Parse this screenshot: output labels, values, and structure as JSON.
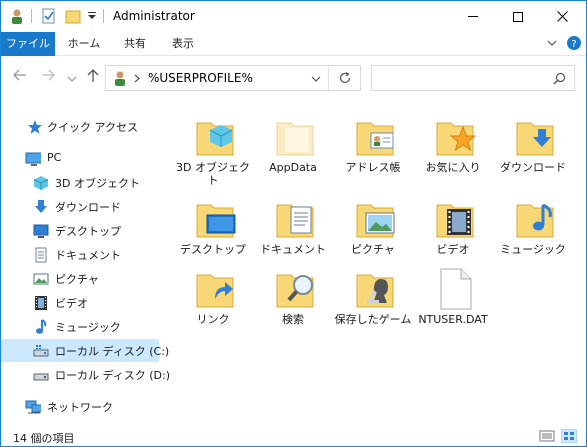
{
  "window": {
    "title": "Administrator"
  },
  "ribbon": {
    "tabs": [
      "ファイル",
      "ホーム",
      "共有",
      "表示"
    ]
  },
  "address": {
    "path": "%USERPROFILE%"
  },
  "search": {
    "placeholder": ""
  },
  "sidebar": {
    "items": [
      {
        "label": "クイック アクセス",
        "icon": "quick-access-star"
      },
      {
        "label": "PC",
        "icon": "pc-monitor"
      },
      {
        "label": "3D オブジェクト",
        "icon": "3d-objects-cube"
      },
      {
        "label": "ダウンロード",
        "icon": "download-arrow"
      },
      {
        "label": "デスクトップ",
        "icon": "desktop-monitor"
      },
      {
        "label": "ドキュメント",
        "icon": "document"
      },
      {
        "label": "ピクチャ",
        "icon": "pictures"
      },
      {
        "label": "ビデオ",
        "icon": "video-film"
      },
      {
        "label": "ミュージック",
        "icon": "music-note"
      },
      {
        "label": "ローカル ディスク (C:)",
        "icon": "local-disk"
      },
      {
        "label": "ローカル ディスク (D:)",
        "icon": "local-disk"
      },
      {
        "label": "ネットワーク",
        "icon": "network"
      }
    ]
  },
  "files": [
    {
      "label": "3D オブジェクト",
      "icon": "3d-objects-folder"
    },
    {
      "label": "AppData",
      "icon": "hidden-folder"
    },
    {
      "label": "アドレス帳",
      "icon": "contacts-folder"
    },
    {
      "label": "お気に入り",
      "icon": "favorites-folder"
    },
    {
      "label": "ダウンロード",
      "icon": "downloads-folder"
    },
    {
      "label": "デスクトップ",
      "icon": "desktop-folder"
    },
    {
      "label": "ドキュメント",
      "icon": "documents-folder"
    },
    {
      "label": "ピクチャ",
      "icon": "pictures-folder"
    },
    {
      "label": "ビデオ",
      "icon": "videos-folder"
    },
    {
      "label": "ミュージック",
      "icon": "music-folder"
    },
    {
      "label": "リンク",
      "icon": "links-folder"
    },
    {
      "label": "検索",
      "icon": "searches-folder"
    },
    {
      "label": "保存したゲーム",
      "icon": "saved-games-folder"
    },
    {
      "label": "NTUSER.DAT",
      "icon": "file"
    }
  ],
  "status": {
    "item_count": "14 個の項目"
  },
  "colors": {
    "accent": "#1979ca",
    "selection": "#cce8ff",
    "folder": "#f8d775"
  }
}
